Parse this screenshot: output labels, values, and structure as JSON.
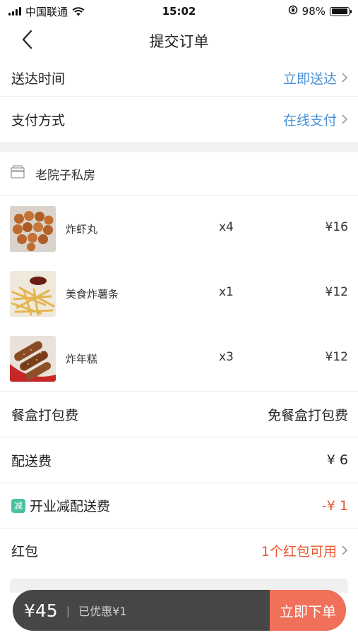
{
  "status_bar": {
    "carrier": "中国联通",
    "time": "15:02",
    "battery_percent": "98%",
    "battery_level": 0.98,
    "icons": [
      "signal-icon",
      "wifi-icon",
      "rotation-lock-icon",
      "battery-icon"
    ]
  },
  "nav": {
    "title": "提交订单",
    "back_icon": "chevron-left-icon"
  },
  "delivery": {
    "label": "送达时间",
    "value": "立即送达"
  },
  "payment": {
    "label": "支付方式",
    "value": "在线支付"
  },
  "shop": {
    "name": "老院子私房",
    "icon": "store-icon"
  },
  "items": [
    {
      "name": "炸虾丸",
      "qty": "x4",
      "price": "¥16",
      "image": "fried-shrimp-balls"
    },
    {
      "name": "美食炸薯条",
      "qty": "x1",
      "price": "¥12",
      "image": "french-fries"
    },
    {
      "name": "炸年糕",
      "qty": "x3",
      "price": "¥12",
      "image": "fried-rice-cake"
    }
  ],
  "packaging": {
    "label": "餐盒打包费",
    "value": "免餐盒打包费"
  },
  "delivery_fee": {
    "label": "配送费",
    "value": "¥ 6"
  },
  "promo": {
    "badge": "减",
    "label": "开业减配送费",
    "value": "-¥ 1"
  },
  "red_packet": {
    "label": "红包",
    "value": "1个红包可用"
  },
  "bottom_bar": {
    "total": "¥45",
    "separator": "|",
    "discount": "已优惠¥1",
    "submit_label": "立即下单"
  },
  "colors": {
    "link_blue": "#4a90d9",
    "accent_red": "#e8572c",
    "submit_bg": "#f0705a",
    "bar_bg": "#464646",
    "promo_green": "#4cc0a0"
  }
}
